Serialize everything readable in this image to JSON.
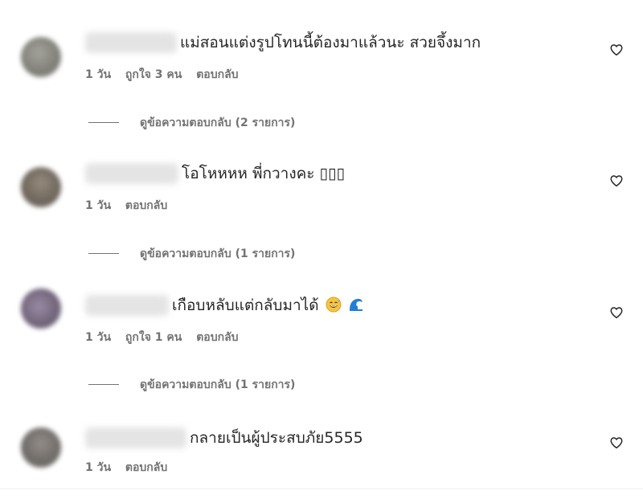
{
  "comments": [
    {
      "text": "แม่สอนแต่งรูปโทนนี้ต้องมาแล้วนะ สวยจึ้งมาก",
      "time": "1 วัน",
      "likes": "ถูกใจ 3 คน",
      "reply": "ตอบกลับ",
      "view_replies": "ดูข้อความตอบกลับ (2 รายการ)",
      "avatar_color": "#8a8a82"
    },
    {
      "text": "โอโหหหห พี่กวางคะ ▯▯▯",
      "time": "1 วัน",
      "likes": "",
      "reply": "ตอบกลับ",
      "view_replies": "ดูข้อความตอบกลับ (1 รายการ)",
      "avatar_color": "#7d746a"
    },
    {
      "text": "เกือบหลับแต่กลับมาได้",
      "emojis": [
        "grinning-sweat-emoji",
        "wave-emoji"
      ],
      "time": "1 วัน",
      "likes": "ถูกใจ 1 คน",
      "reply": "ตอบกลับ",
      "view_replies": "ดูข้อความตอบกลับ (1 รายการ)",
      "avatar_color": "#7d6f86"
    },
    {
      "text": "กลายเป็นผู้ประสบภัย5555",
      "time": "1 วัน",
      "likes": "",
      "reply": "ตอบกลับ",
      "view_replies": "",
      "avatar_color": "#7a7672"
    }
  ],
  "icons": {
    "like": "heart-outline-icon"
  },
  "colors": {
    "text": "#262626",
    "meta": "#737373",
    "divider": "#efefef"
  }
}
